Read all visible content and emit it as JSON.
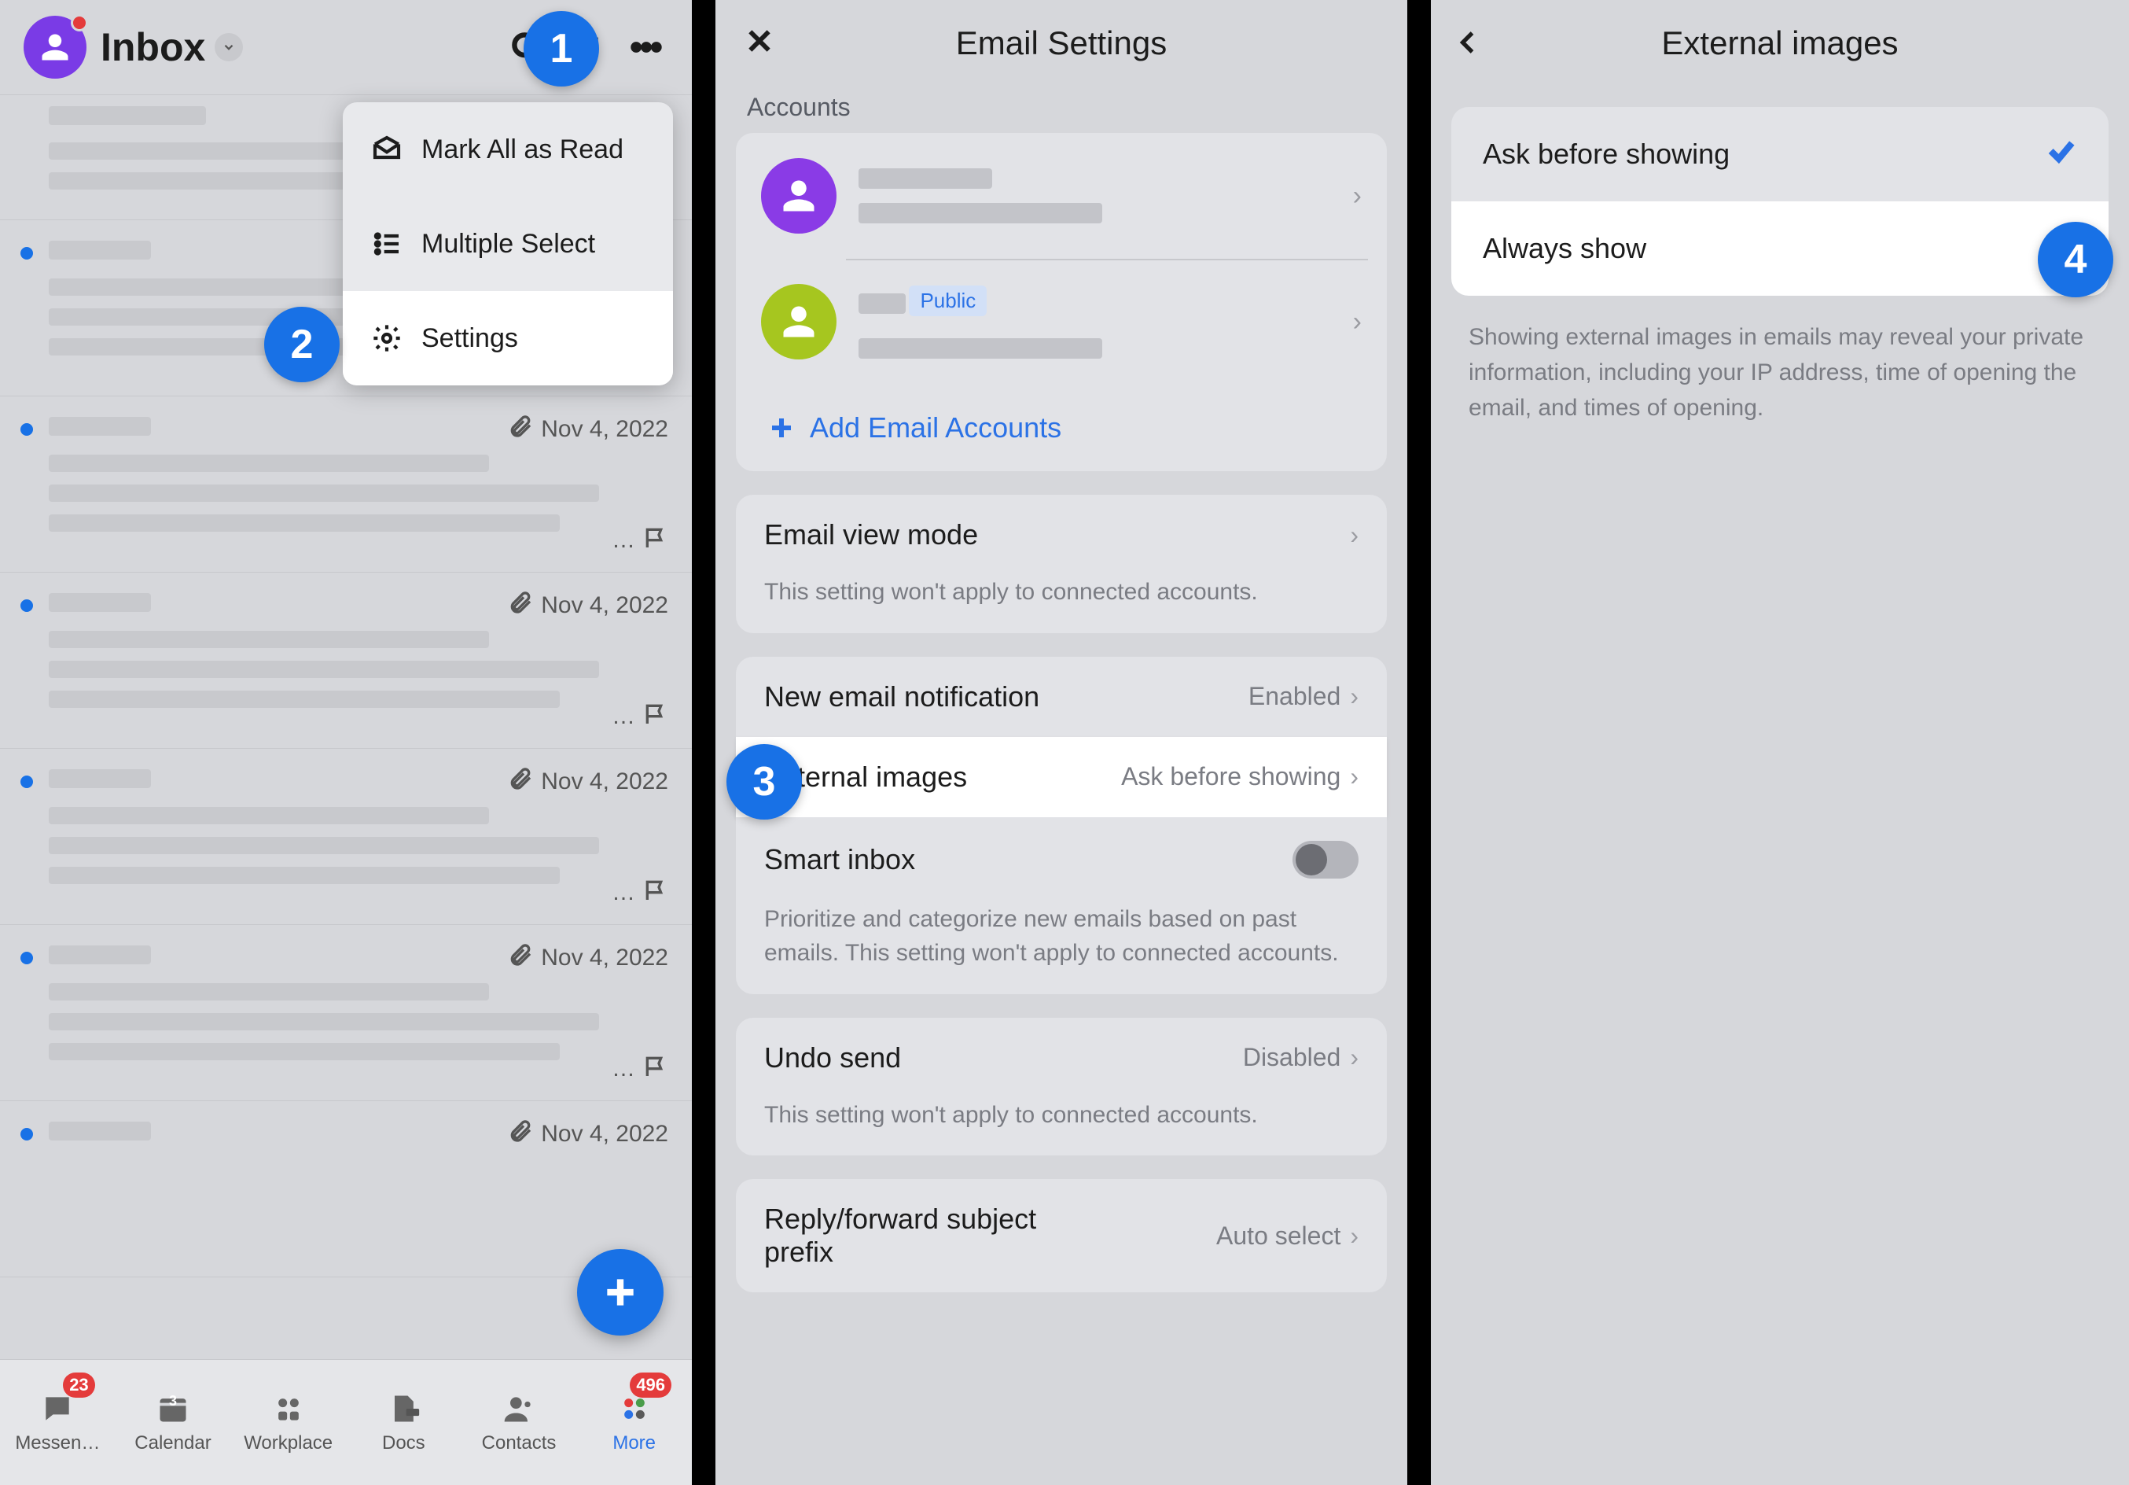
{
  "steps": {
    "s1": "1",
    "s2": "2",
    "s3": "3",
    "s4": "4"
  },
  "panel1": {
    "title": "Inbox",
    "menu": {
      "mark_read": "Mark All as Read",
      "multi_select": "Multiple Select",
      "settings": "Settings"
    },
    "date": "Nov 4, 2022",
    "tabs": {
      "messenger": "Messen…",
      "calendar": "Calendar",
      "workplace": "Workplace",
      "docs": "Docs",
      "contacts": "Contacts",
      "more": "More",
      "badge_messenger": "23",
      "badge_more": "496",
      "cal_day": "3"
    }
  },
  "panel2": {
    "title": "Email Settings",
    "section_accounts": "Accounts",
    "public_tag": "Public",
    "add_accounts": "Add Email Accounts",
    "view_mode": "Email view mode",
    "view_mode_desc": "This setting won't apply to connected accounts.",
    "new_email": "New email notification",
    "new_email_val": "Enabled",
    "ext_images": "External images",
    "ext_images_val": "Ask before showing",
    "smart_inbox": "Smart inbox",
    "smart_inbox_desc": "Prioritize and categorize new emails based on past emails. This setting won't apply to connected accounts.",
    "undo_send": "Undo send",
    "undo_send_val": "Disabled",
    "undo_send_desc": "This setting won't apply to connected accounts.",
    "reply_prefix": "Reply/forward subject prefix",
    "reply_prefix_val": "Auto select"
  },
  "panel3": {
    "title": "External images",
    "opt_ask": "Ask before showing",
    "opt_always": "Always show",
    "desc": "Showing external images in emails may reveal your private information, including your IP address, time of opening the email, and times of opening."
  }
}
